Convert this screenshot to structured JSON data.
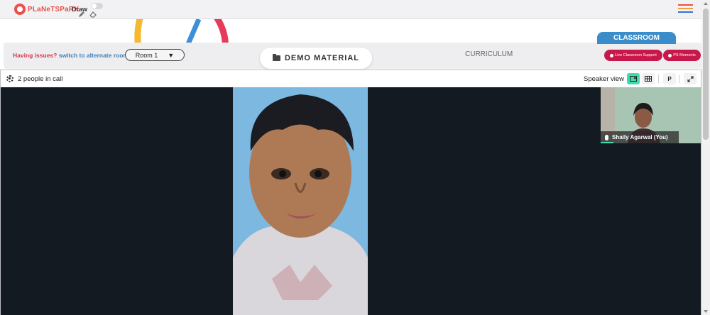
{
  "topbar": {
    "brand": "PLaNeTSPaRK",
    "draw_label": "Draw",
    "menu_colors": [
      "#e8504a",
      "#f2a13a",
      "#3a6fd8"
    ]
  },
  "controls": {
    "issues_text": "Having issues?",
    "alternate_link": "switch to alternate room",
    "room_select_value": "Room 1",
    "demo_material_label": "DEMO MATERIAL",
    "curriculum_label": "CURRICULUM",
    "classroom_tab": "CLASSROOM",
    "live_support_label": "Live Classroom Support",
    "ps_moments_label": "PS Moments"
  },
  "call": {
    "people_count": "2 people in call",
    "speaker_view_label": "Speaker view",
    "presenter_button": "P",
    "participant_name": "Shaily Agarwal (You)"
  },
  "colors": {
    "accent_teal": "#3fdcb0",
    "brand_red": "#c8184a",
    "classroom_blue": "#3a8dc8",
    "stage_bg": "#131a22"
  },
  "icons": [
    "pencil-icon",
    "eraser-icon",
    "menu-icon",
    "folder-icon",
    "gear-icon",
    "speaker-view-icon",
    "grid-view-icon",
    "expand-icon",
    "mic-icon"
  ]
}
